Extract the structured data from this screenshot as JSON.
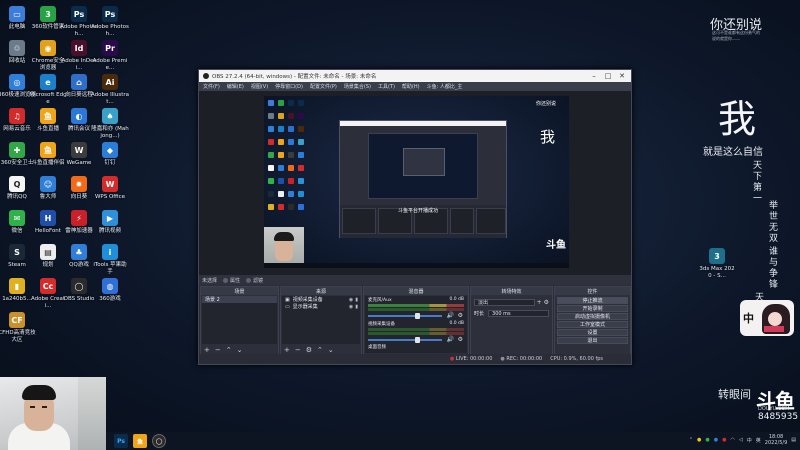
{
  "desktop_icons": [
    {
      "label": "此电脑",
      "color": "#3b7dd8",
      "glyph": "▭"
    },
    {
      "label": "360软件管家",
      "color": "#27a346",
      "glyph": "3"
    },
    {
      "label": "Adobe Photosh...",
      "color": "#0b2b4a",
      "glyph": "Ps"
    },
    {
      "label": "Adobe Photosh...",
      "color": "#0b2b4a",
      "glyph": "Ps"
    },
    {
      "label": "回收站",
      "color": "#6d7a8a",
      "glyph": "♲"
    },
    {
      "label": "Chrome安全浏览器",
      "color": "#e0a21b",
      "glyph": "◉"
    },
    {
      "label": "Adobe InDesi...",
      "color": "#4a0f2a",
      "glyph": "Id"
    },
    {
      "label": "Adobe Premie...",
      "color": "#2a0a4a",
      "glyph": "Pr"
    },
    {
      "label": "360极速浏览器",
      "color": "#2f7fd8",
      "glyph": "◎"
    },
    {
      "label": "Microsoft Edge",
      "color": "#1c7fc9",
      "glyph": "e"
    },
    {
      "label": "向日葵远程",
      "color": "#2f6fc9",
      "glyph": "⌂"
    },
    {
      "label": "Adobe Illustrat...",
      "color": "#4a2a0a",
      "glyph": "Ai"
    },
    {
      "label": "网易云音乐",
      "color": "#d12b2b",
      "glyph": "♫"
    },
    {
      "label": "斗鱼直播",
      "color": "#f0a418",
      "glyph": "鱼"
    },
    {
      "label": "腾讯会议",
      "color": "#2b78d8",
      "glyph": "◐"
    },
    {
      "label": "隆嘉和亦 (Mahjong...)",
      "color": "#39a0c9",
      "glyph": "♠"
    },
    {
      "label": "360安全卫士",
      "color": "#33a64a",
      "glyph": "✚"
    },
    {
      "label": "斗鱼直播伴侣",
      "color": "#f0a418",
      "glyph": "鱼"
    },
    {
      "label": "WeGame",
      "color": "#3c3c3c",
      "glyph": "W"
    },
    {
      "label": "钉钉",
      "color": "#2b7ed8",
      "glyph": "◆"
    },
    {
      "label": "腾讯QQ",
      "color": "#f5f5f5",
      "glyph": "Q"
    },
    {
      "label": "鲁大师",
      "color": "#2f7fd8",
      "glyph": "☺"
    },
    {
      "label": "向日葵",
      "color": "#f06a18",
      "glyph": "✹"
    },
    {
      "label": "WPS Office",
      "color": "#d62b2b",
      "glyph": "W"
    },
    {
      "label": "微信",
      "color": "#2fb24a",
      "glyph": "✉"
    },
    {
      "label": "HelloFont",
      "color": "#1f4fa8",
      "glyph": "H"
    },
    {
      "label": "雷神加速器",
      "color": "#c9202a",
      "glyph": "⚡"
    },
    {
      "label": "腾讯视频",
      "color": "#2f8fd8",
      "glyph": "▶"
    },
    {
      "label": "Steam",
      "color": "#1b2838",
      "glyph": "S"
    },
    {
      "label": "规划",
      "color": "#eeeeee",
      "glyph": "▤"
    },
    {
      "label": "QQ游戏",
      "color": "#2f7fd8",
      "glyph": "♣"
    },
    {
      "label": "iTools 苹果助手",
      "color": "#1f8fd8",
      "glyph": "i"
    },
    {
      "label": "1a240b5...",
      "color": "#e0b020",
      "glyph": "▮"
    },
    {
      "label": "Adobe Creati...",
      "color": "#d62b2b",
      "glyph": "Cc"
    },
    {
      "label": "OBS Studio",
      "color": "#2b2b2b",
      "glyph": "◯"
    },
    {
      "label": "360游戏",
      "color": "#2f6fd8",
      "glyph": "◍"
    },
    {
      "label": "CFHD高清竞技大区",
      "color": "#c9902b",
      "glyph": "CF"
    }
  ],
  "poster": {
    "headline": "你还别说",
    "sub_lines": [
      "这可不是谁都有这份勇气的",
      "说的就是你——"
    ],
    "big_char": "我",
    "tagline": "就是这么自信",
    "vertical_1": "天下第一",
    "vertical_2": "举世无双",
    "vertical_3": "谁与争锋",
    "vertical_4": "天",
    "sticker": "中",
    "desktop_3dsmax_label": "3ds Max 2020 - S..."
  },
  "obs": {
    "title": "OBS 27.2.4 (64-bit, windows) - 配置文件: 未命名 - 场景: 未命名",
    "menu": [
      "文件(F)",
      "编辑(E)",
      "视图(V)",
      "停靠窗口(D)",
      "配置文件(P)",
      "场景集合(S)",
      "工具(T)",
      "帮助(H)",
      "斗鱼: 人都比_主"
    ],
    "scene_bar": {
      "label": "未选择",
      "prop1": "属性",
      "prop2": "滤镜"
    },
    "preview_caption": "斗鱼平台开播成功",
    "scenes": {
      "title": "场景",
      "items": [
        "场景 2"
      ]
    },
    "sources": {
      "title": "来源",
      "items": [
        "视频采集设备",
        "显示器采集"
      ]
    },
    "mixer": {
      "title": "混音器",
      "channels": [
        {
          "name": "麦克风/Aux",
          "db": "0.0 dB",
          "level": 0.64
        },
        {
          "name": "视频采集设备",
          "db": "0.0 dB",
          "level": 0.64
        }
      ],
      "extra": "桌面音频"
    },
    "transitions": {
      "title": "转场特效",
      "type": "淡出",
      "duration_label": "时长",
      "duration": "300 ms"
    },
    "controls": {
      "title": "控件",
      "buttons": [
        "停止推流",
        "开始录制",
        "启动虚拟摄像机",
        "工作室模式",
        "设置",
        "退出"
      ]
    },
    "status": {
      "live": "LIVE: 00:00:00",
      "rec": "REC: 00:00:00",
      "cpu": "CPU: 0.9%, 60.00 fps"
    }
  },
  "taskbar": {
    "time": "18:08",
    "date": "2022/5/9",
    "tray_labels": [
      "中",
      "英"
    ]
  },
  "watermark": {
    "text": "转眼间",
    "logo": "斗鱼",
    "url": "DOUYU.COM",
    "room": "8485935"
  }
}
